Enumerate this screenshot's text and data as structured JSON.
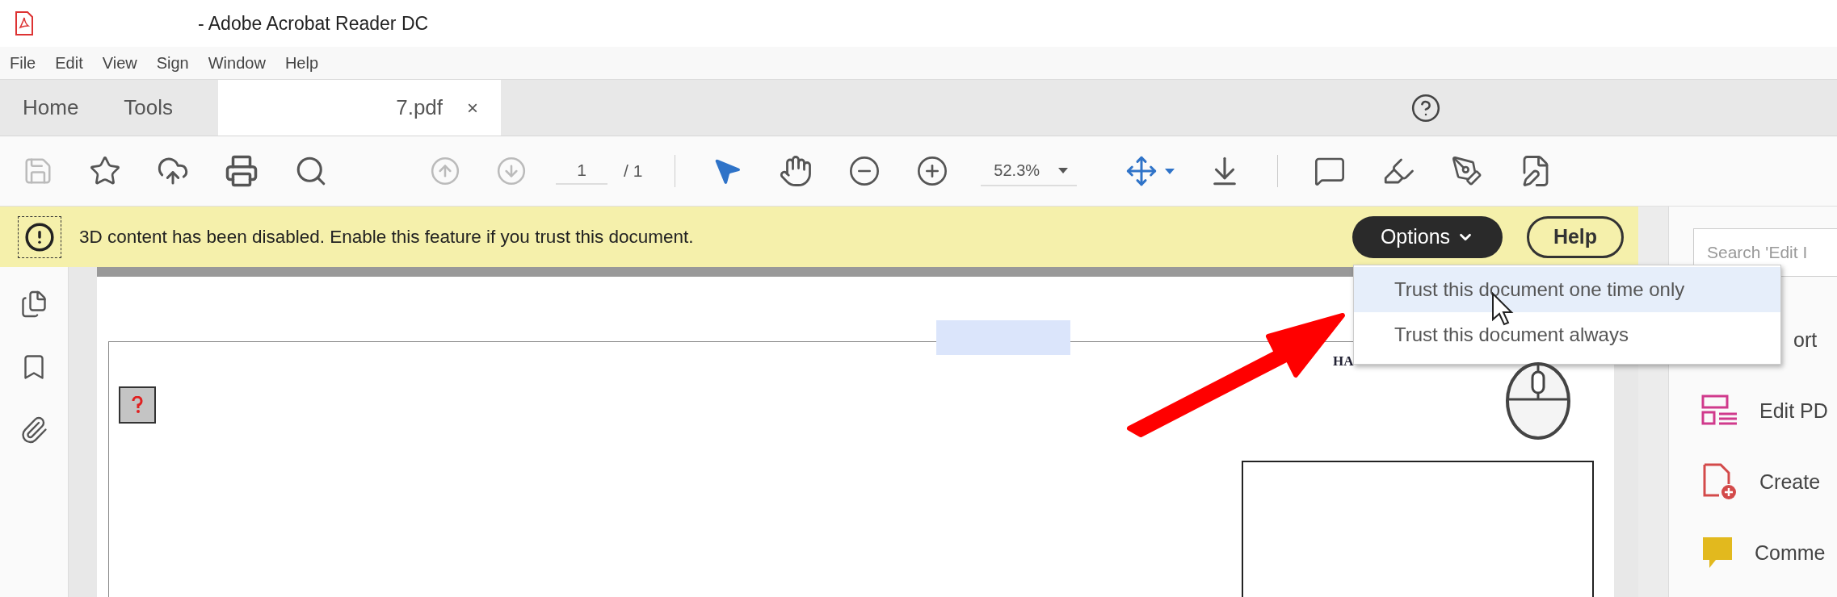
{
  "window": {
    "title": "- Adobe Acrobat Reader DC"
  },
  "menu": [
    "File",
    "Edit",
    "View",
    "Sign",
    "Window",
    "Help"
  ],
  "tabs": [
    {
      "label": "Home",
      "selected": false
    },
    {
      "label": "Tools",
      "selected": false
    },
    {
      "label": "7.pdf",
      "selected": true,
      "close": "×"
    }
  ],
  "toolbar": {
    "save_disabled": true,
    "previous_disabled": true,
    "next_disabled": true,
    "page": "1",
    "page_total": "/ 1",
    "zoom": "52.3%"
  },
  "notice": {
    "message": "3D content has been disabled. Enable this feature if you trust this document.",
    "options": "Options",
    "help": "Help"
  },
  "dropdown": {
    "items": [
      {
        "label": "Trust this document one time only",
        "selected": true
      },
      {
        "label": "Trust this document always",
        "selected": false
      }
    ]
  },
  "right_panel": {
    "search_placeholder": "Search 'Edit I",
    "items": [
      {
        "label": "ort",
        "kind": "hidden"
      },
      {
        "label": "Edit PD",
        "kind": "edit"
      },
      {
        "label": "Create",
        "kind": "create"
      },
      {
        "label": "Comme",
        "kind": "comment"
      }
    ]
  },
  "document": {
    "heading": "HA"
  }
}
